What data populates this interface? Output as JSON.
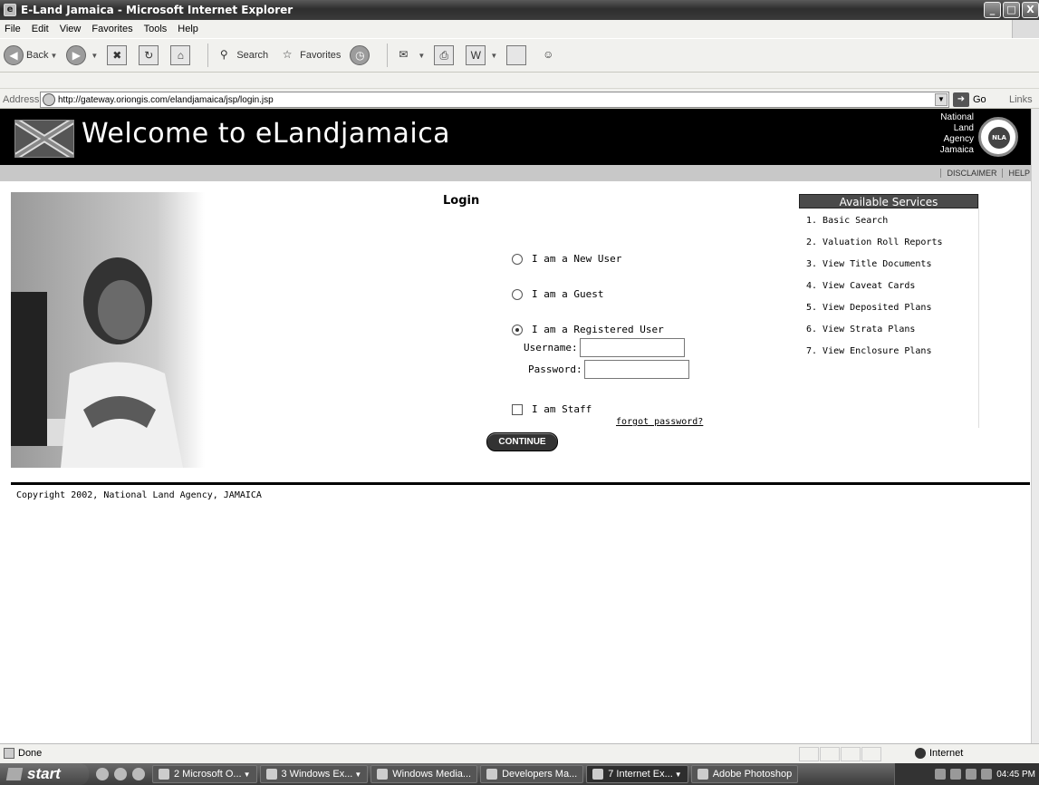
{
  "window": {
    "title": "E-Land Jamaica - Microsoft Internet Explorer",
    "buttons": [
      "_",
      "□",
      "X"
    ]
  },
  "menu": [
    "File",
    "Edit",
    "View",
    "Favorites",
    "Tools",
    "Help"
  ],
  "toolbar": {
    "back": "Back",
    "search": "Search",
    "favorites": "Favorites"
  },
  "address": {
    "label": "Address",
    "url": "http://gateway.oriongis.com/elandjamaica/jsp/login.jsp",
    "go": "Go",
    "links": "Links"
  },
  "banner": {
    "welcome": "Welcome to eLandjamaica",
    "agency_lines": [
      "National",
      "Land",
      "Agency",
      "Jamaica"
    ],
    "seal": "NLA"
  },
  "top_links": [
    "DISCLAIMER",
    "HELP"
  ],
  "login": {
    "title": "Login",
    "options": [
      {
        "label": "I am a New User",
        "selected": false
      },
      {
        "label": "I am a Guest",
        "selected": false
      },
      {
        "label": "I am a Registered User",
        "selected": true
      }
    ],
    "username_label": "Username:",
    "password_label": "Password:",
    "username_value": "",
    "password_value": "",
    "staff_label": "I am Staff",
    "staff_checked": false,
    "forgot": "forgot password?",
    "continue": "CONTINUE"
  },
  "services": {
    "title": "Available Services",
    "items": [
      "1. Basic Search",
      "2. Valuation Roll Reports",
      "3. View Title Documents",
      "4. View Caveat Cards",
      "5. View Deposited Plans",
      "6. View Strata Plans",
      "7. View Enclosure Plans"
    ]
  },
  "footer": {
    "copyright": "Copyright 2002, National Land Agency, JAMAICA"
  },
  "status": {
    "text": "Done",
    "zone": "Internet"
  },
  "taskbar": {
    "start": "start",
    "tasks": [
      {
        "label": "2 Microsoft O...",
        "active": false
      },
      {
        "label": "3 Windows Ex...",
        "active": false
      },
      {
        "label": "Windows Media...",
        "active": false
      },
      {
        "label": "Developers Ma...",
        "active": false
      },
      {
        "label": "7 Internet Ex...",
        "active": true
      },
      {
        "label": "Adobe Photoshop",
        "active": false
      }
    ],
    "clock": "04:45 PM"
  }
}
